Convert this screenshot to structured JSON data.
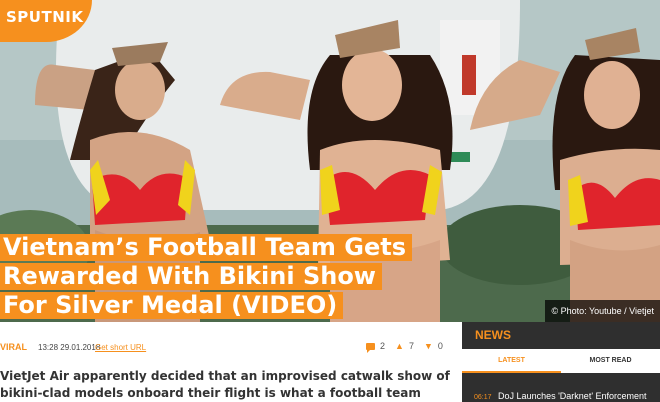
{
  "logo": {
    "text": "SPUTNIK"
  },
  "headline": {
    "line1": "Vietnam’s Football Team Gets",
    "line2": "Rewarded With Bikini Show",
    "line3": "For Silver Medal (VIDEO)"
  },
  "photo_credit": "© Photo: Youtube / Vietjet",
  "meta": {
    "category": "VIRAL",
    "datetime": "13:28 29.01.2018",
    "short_url": "Get short URL",
    "comments": "2",
    "likes": "7",
    "dislikes": "0"
  },
  "lead": "VietJet Air apparently decided that an improvised catwalk show of bikini-clad models onboard their flight is what a football team needs after",
  "news": {
    "title": "NEWS",
    "tabs": [
      {
        "label": "LATEST",
        "active": true
      },
      {
        "label": "MOST READ",
        "active": false
      }
    ],
    "items": [
      {
        "time": "06:17",
        "text": "DoJ Launches 'Darknet' Enforcement"
      }
    ]
  },
  "colors": {
    "accent": "#f6901e",
    "sidebar": "#2f2f2f"
  }
}
